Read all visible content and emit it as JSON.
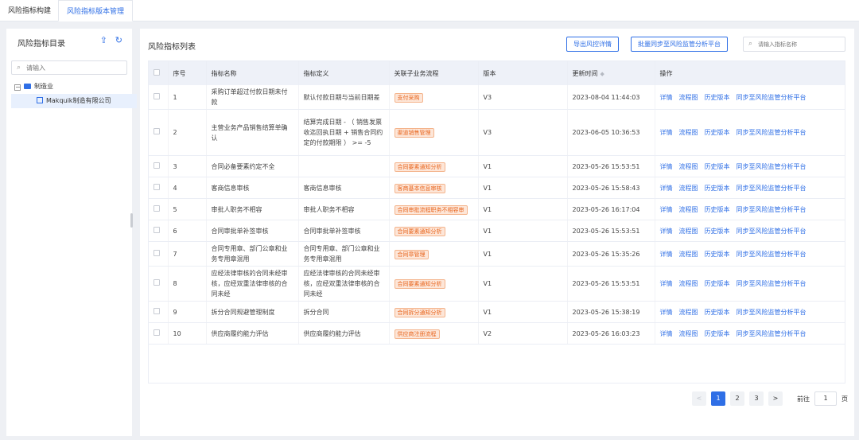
{
  "tabs": [
    {
      "label": "风险指标构建",
      "active": false
    },
    {
      "label": "风险指标版本管理",
      "active": true
    }
  ],
  "sidebar": {
    "title": "风险指标目录",
    "icons": [
      "upload-icon",
      "refresh-icon"
    ],
    "search_placeholder": "请输入",
    "tree": [
      {
        "label": "制造业",
        "expand_glyph": "−",
        "children": [
          {
            "label": "Makquik制造有限公司"
          }
        ]
      }
    ]
  },
  "main": {
    "title": "风险指标列表",
    "buttons": {
      "export": "导出风控详情",
      "sync_all": "批量同步至风险监管分析平台"
    },
    "search_placeholder": "请输入指标名称",
    "columns": [
      "序号",
      "指标名称",
      "指标定义",
      "关联子业务流程",
      "版本",
      "更新时间",
      "操作"
    ],
    "actions": [
      "详情",
      "流程图",
      "历史版本",
      "同步至风险监管分析平台"
    ],
    "rows": [
      {
        "no": "1",
        "name": "采购订单超过付款日期未付款",
        "definition": "默认付款日期与当前日期差",
        "process": "支付采购",
        "version": "V3",
        "updated": "2023-08-04 11:44:03"
      },
      {
        "no": "2",
        "name": "主营业务产品销售结算单确认",
        "definition": "结算完成日期 - （ 销售发票收迄回执日期 + 销售合同约定的付款期限 ） >= -5",
        "process": "渠道销售管理",
        "version": "V3",
        "updated": "2023-06-05 10:36:53"
      },
      {
        "no": "3",
        "name": "合同必备要素约定不全",
        "definition": "",
        "process": "合同要素通知分析",
        "version": "V1",
        "updated": "2023-05-26 15:53:51"
      },
      {
        "no": "4",
        "name": "客商信息审核",
        "definition": "客商信息审核",
        "process": "客商基本信息审核",
        "version": "V1",
        "updated": "2023-05-26 15:58:43"
      },
      {
        "no": "5",
        "name": "审批人职务不相容",
        "definition": "审批人职务不相容",
        "process": "合同审批流程职务不相容审",
        "version": "V1",
        "updated": "2023-05-26 16:17:04"
      },
      {
        "no": "6",
        "name": "合同审批单补签审核",
        "definition": "合同审批单补签审核",
        "process": "合同要素通知分析",
        "version": "V1",
        "updated": "2023-05-26 15:53:51"
      },
      {
        "no": "7",
        "name": "合同专用章、部门公章和业务专用章混用",
        "definition": "合同专用章、部门公章和业务专用章混用",
        "process": "合同章管理",
        "version": "V1",
        "updated": "2023-05-26 15:35:26"
      },
      {
        "no": "8",
        "name": "应经法律审核的合同未经审核，应经双重法律审核的合同未经",
        "definition": "应经法律审核的合同未经审核，应经双重法律审核的合同未经",
        "process": "合同要素通知分析",
        "version": "V1",
        "updated": "2023-05-26 15:53:51"
      },
      {
        "no": "9",
        "name": "拆分合同规避管理制度",
        "definition": "拆分合同",
        "process": "合同拆分通知分析",
        "version": "V1",
        "updated": "2023-05-26 15:38:19"
      },
      {
        "no": "10",
        "name": "供应商履约能力评估",
        "definition": "供应商履约能力评估",
        "process": "供应商注册流程",
        "version": "V2",
        "updated": "2023-05-26 16:03:23"
      }
    ]
  },
  "pagination": {
    "prev": "<",
    "pages": [
      "1",
      "2",
      "3"
    ],
    "current": "1",
    "next": ">",
    "goto_label": "前往",
    "goto_value": "1",
    "page_suffix": "页"
  },
  "colors": {
    "accent": "#2f6fe6",
    "tag_bg": "#fde6d8",
    "tag_text": "#e8661f"
  }
}
